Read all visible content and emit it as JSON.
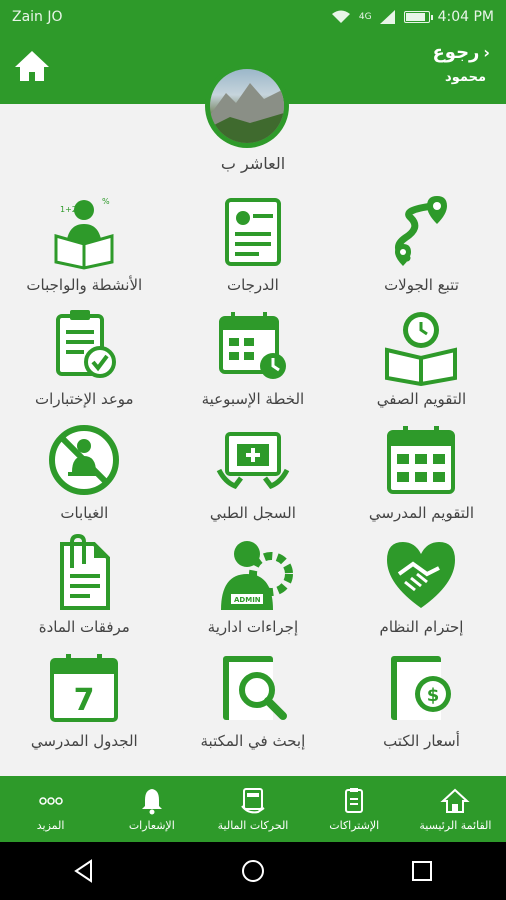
{
  "status_bar": {
    "carrier": "Zain JO",
    "network": "4G",
    "time": "4:04 PM",
    "battery_level": 0.9
  },
  "header": {
    "back_label": "رجوع",
    "user_name": "محمود",
    "home_icon": "home-icon"
  },
  "profile": {
    "class_name": "العاشر ب"
  },
  "tiles": [
    {
      "label": "تتبع الجولات",
      "icon": "route-tracking-icon"
    },
    {
      "label": "الدرجات",
      "icon": "certificate-icon"
    },
    {
      "label": "الأنشطة والواجبات",
      "icon": "student-reading-icon"
    },
    {
      "label": "التقويم الصفي",
      "icon": "book-clock-icon"
    },
    {
      "label": "الخطة الإسبوعية",
      "icon": "calendar-clock-icon"
    },
    {
      "label": "موعد الإختبارات",
      "icon": "clipboard-check-icon"
    },
    {
      "label": "التقويم المدرسي",
      "icon": "calendar-grid-icon"
    },
    {
      "label": "السجل الطبي",
      "icon": "medical-record-icon"
    },
    {
      "label": "الغيابات",
      "icon": "absence-icon"
    },
    {
      "label": "إحترام النظام",
      "icon": "handshake-heart-icon"
    },
    {
      "label": "إجراءات ادارية",
      "icon": "admin-gear-icon"
    },
    {
      "label": "مرفقات المادة",
      "icon": "attachment-icon"
    },
    {
      "label": "أسعار الكتب",
      "icon": "book-price-icon"
    },
    {
      "label": "إبحث في المكتبة",
      "icon": "library-search-icon"
    },
    {
      "label": "الجدول المدرسي",
      "icon": "calendar-seven-icon",
      "day": "7"
    }
  ],
  "bottom_nav": [
    {
      "label": "القائمة الرئيسية",
      "icon": "home-icon"
    },
    {
      "label": "الإشتراكات",
      "icon": "subscriptions-icon"
    },
    {
      "label": "الحركات المالية",
      "icon": "payments-icon"
    },
    {
      "label": "الإشعارات",
      "icon": "bell-icon"
    },
    {
      "label": "المزيد",
      "icon": "more-icon"
    }
  ],
  "colors": {
    "primary": "#2e9a2a",
    "background": "#f2f2f2",
    "text": "#444444"
  }
}
